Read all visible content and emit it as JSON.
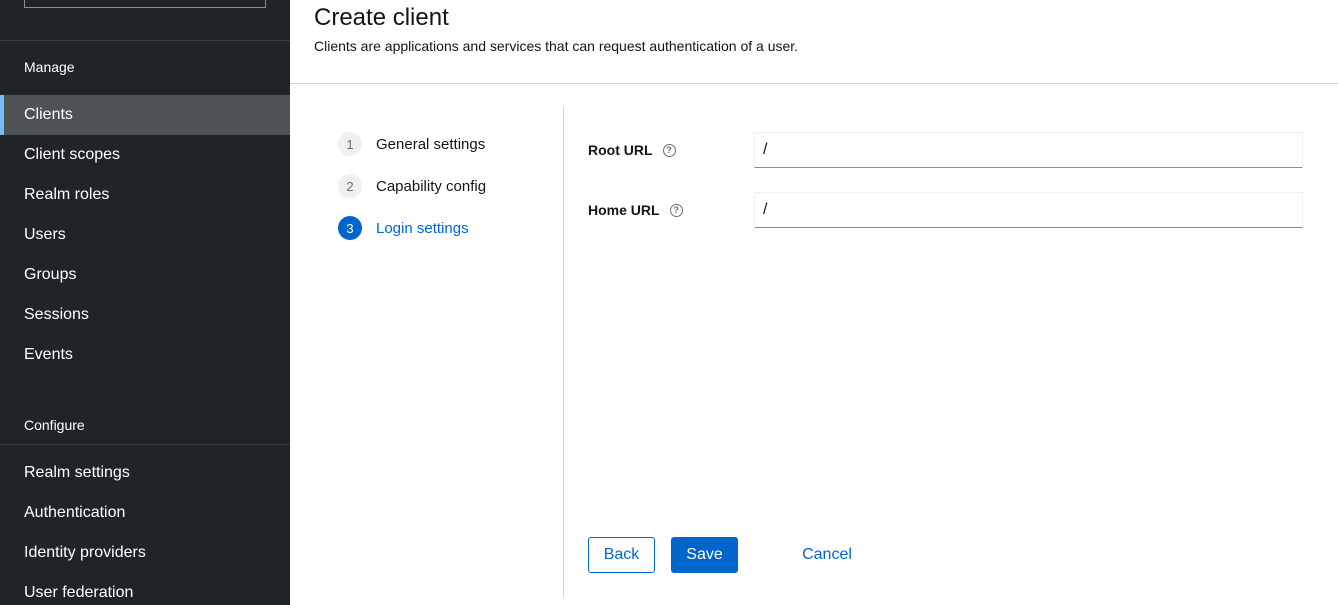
{
  "sidebar": {
    "manage_title": "Manage",
    "manage_items": [
      {
        "label": "Clients"
      },
      {
        "label": "Client scopes"
      },
      {
        "label": "Realm roles"
      },
      {
        "label": "Users"
      },
      {
        "label": "Groups"
      },
      {
        "label": "Sessions"
      },
      {
        "label": "Events"
      }
    ],
    "configure_title": "Configure",
    "configure_items": [
      {
        "label": "Realm settings"
      },
      {
        "label": "Authentication"
      },
      {
        "label": "Identity providers"
      },
      {
        "label": "User federation"
      }
    ],
    "active_item": "Clients"
  },
  "header": {
    "title": "Create client",
    "description": "Clients are applications and services that can request authentication of a user."
  },
  "wizard": {
    "steps": [
      {
        "number": "1",
        "label": "General settings"
      },
      {
        "number": "2",
        "label": "Capability config"
      },
      {
        "number": "3",
        "label": "Login settings"
      }
    ],
    "current_step": "3"
  },
  "form": {
    "root_url": {
      "label": "Root URL",
      "value": "/",
      "help_icon": "question-circle-icon"
    },
    "home_url": {
      "label": "Home URL",
      "value": "/",
      "help_icon": "question-circle-icon"
    }
  },
  "actions": {
    "back_label": "Back",
    "save_label": "Save",
    "cancel_label": "Cancel"
  },
  "colors": {
    "sidebar_bg": "#212427",
    "active_nav_bg": "#4f5255",
    "active_nav_accent": "#73bcf7",
    "primary": "#0066cc"
  }
}
